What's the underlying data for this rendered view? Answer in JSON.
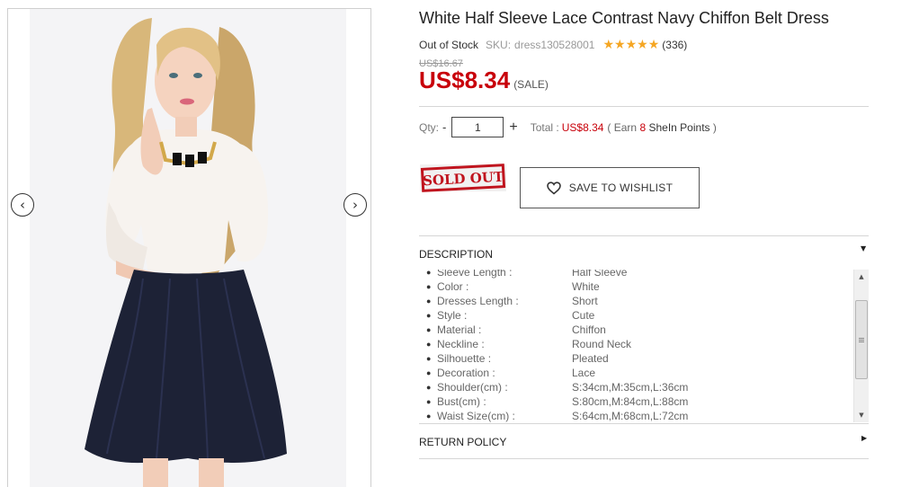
{
  "product": {
    "title": "White Half Sleeve Lace Contrast Navy Chiffon Belt Dress",
    "stock_status": "Out of Stock",
    "sku_label": "SKU:",
    "sku_value": "dress130528001",
    "rating_stars": 5,
    "review_count": "(336)",
    "old_price": "US$16.67",
    "price": "US$8.34",
    "sale_label": "(SALE)"
  },
  "gallery": {
    "prev_icon": "chevron-left-icon",
    "next_icon": "chevron-right-icon",
    "prev_glyph": "‹",
    "next_glyph": "›"
  },
  "purchase": {
    "qty_label": "Qty:",
    "qty_minus": "-",
    "qty_value": "1",
    "qty_plus": "+",
    "total_label": "Total :",
    "total_value": "US$8.34",
    "earn_prefix": "( Earn",
    "earn_points": "8",
    "earn_suffix_brand": "SheIn Points",
    "earn_close": ")",
    "soldout_text": "SOLD OUT",
    "wishlist_label": "SAVE TO WISHLIST"
  },
  "description": {
    "heading": "DESCRIPTION",
    "caret": "▼",
    "items": [
      {
        "k": "Sleeve Length :",
        "v": "Half Sleeve"
      },
      {
        "k": "Color :",
        "v": "White"
      },
      {
        "k": "Dresses Length :",
        "v": "Short"
      },
      {
        "k": "Style :",
        "v": "Cute"
      },
      {
        "k": "Material :",
        "v": "Chiffon"
      },
      {
        "k": "Neckline :",
        "v": "Round Neck"
      },
      {
        "k": "Silhouette :",
        "v": "Pleated"
      },
      {
        "k": "Decoration :",
        "v": "Lace"
      },
      {
        "k": "Shoulder(cm) :",
        "v": "S:34cm,M:35cm,L:36cm"
      },
      {
        "k": "Bust(cm) :",
        "v": "S:80cm,M:84cm,L:88cm"
      },
      {
        "k": "Waist Size(cm) :",
        "v": "S:64cm,M:68cm,L:72cm"
      }
    ]
  },
  "return_policy": {
    "heading": "RETURN POLICY",
    "caret": "▶"
  },
  "colors": {
    "price_red": "#c8000a",
    "star_gold": "#f5a623",
    "dress_navy": "#1d2236"
  }
}
